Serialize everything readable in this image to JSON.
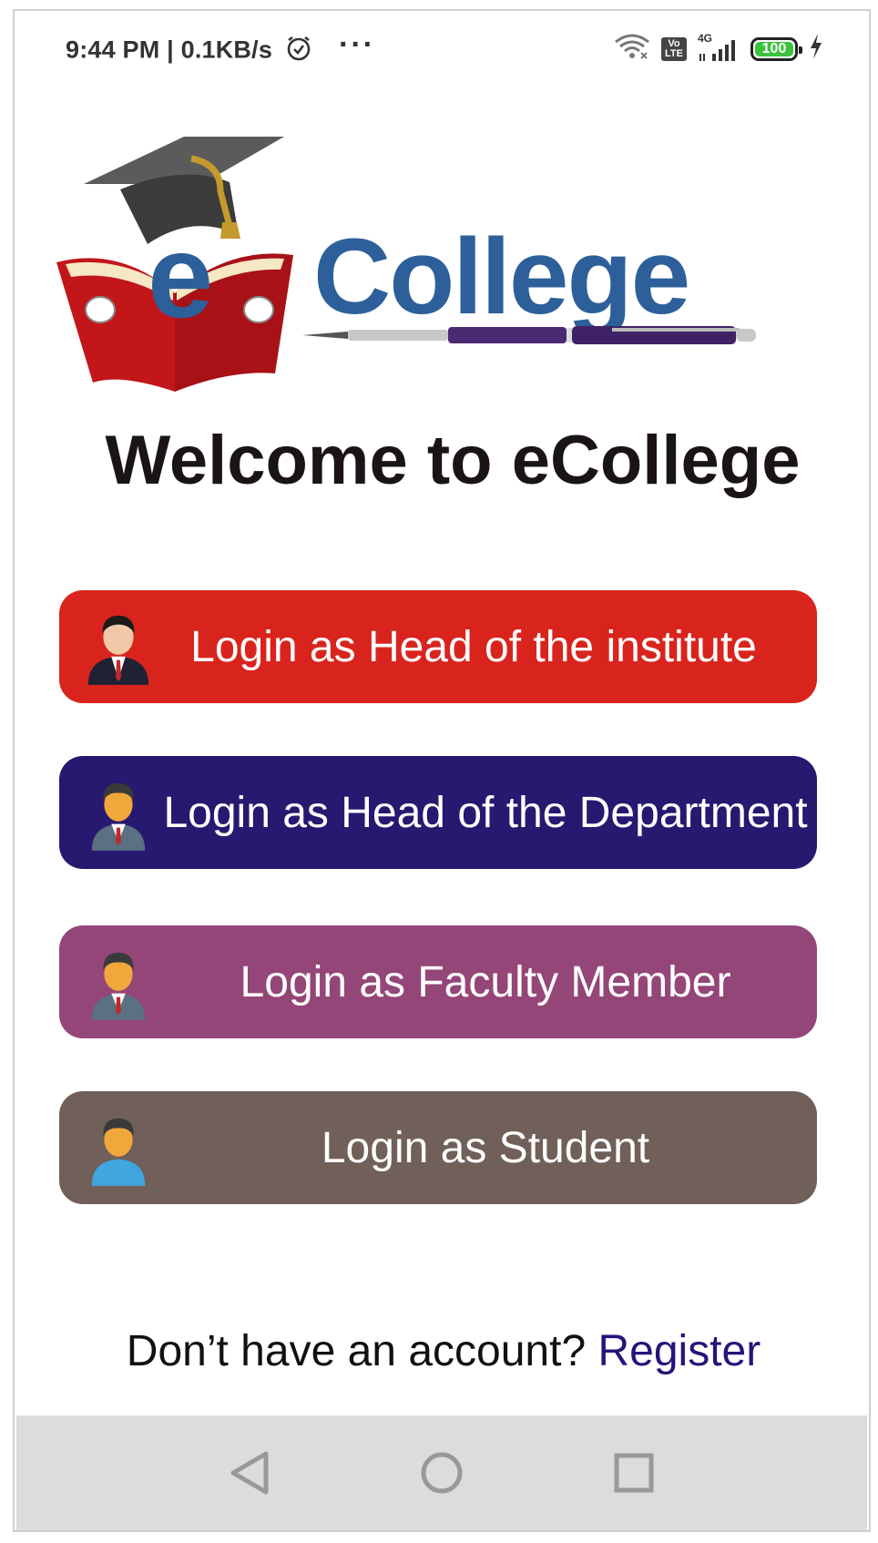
{
  "status_bar": {
    "time_speed": "9:44 PM | 0.1KB/s",
    "overflow": "···",
    "volte": "Vo LTE",
    "network": "4G",
    "battery": "100"
  },
  "logo": {
    "e": "e",
    "word": "College"
  },
  "welcome_title": "Welcome to eCollege",
  "buttons": [
    {
      "label": "Login as Head of the institute",
      "color": "#d9241d"
    },
    {
      "label": "Login as Head of the Department",
      "color": "#271870"
    },
    {
      "label": "Login as Faculty Member",
      "color": "#944678"
    },
    {
      "label": "Login as Student",
      "color": "#706059"
    }
  ],
  "register": {
    "prompt": "Don’t have an account? ",
    "link": "Register"
  },
  "icons": {
    "alarm": "alarm-icon",
    "wifi": "wifi-icon",
    "signal": "signal-icon",
    "charging": "charging-icon",
    "nav_back": "back-icon",
    "nav_home": "home-icon",
    "nav_recents": "recents-icon"
  }
}
